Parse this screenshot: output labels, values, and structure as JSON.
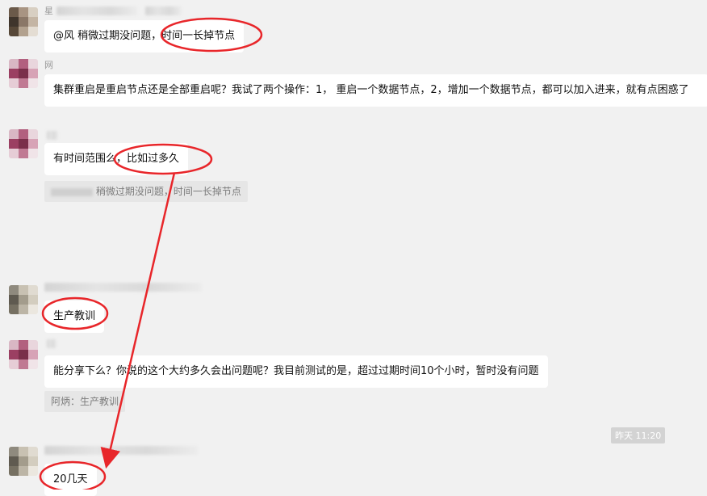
{
  "messages": [
    {
      "name_char": "星",
      "text": "@风 稍微过期没问题，时间一长掉节点"
    },
    {
      "name_char": "网",
      "text": "集群重启是重启节点还是全部重启呢？我试了两个操作：1， 重启一个数据节点，2，增加一个数据节点，都可以加入进来，就有点困惑了"
    },
    {
      "name_char": "",
      "text": "有时间范围么，比如过多久",
      "quote": "稍微过期没问题，时间一长掉节点"
    },
    {
      "name_char": "",
      "text": "生产教训"
    },
    {
      "name_char": "",
      "text": "能分享下么？你说的这个大约多久会出问题呢？我目前测试的是，超过过期时间10个小时，暂时没有问题",
      "quote": "阿炳：生产教训"
    },
    {
      "name_char": "",
      "text": "20几天"
    }
  ],
  "timestamp": "昨天 11:20",
  "colors": {
    "background": "#f1f1f1",
    "bubble": "#ffffff",
    "annotation": "#e8262a"
  }
}
